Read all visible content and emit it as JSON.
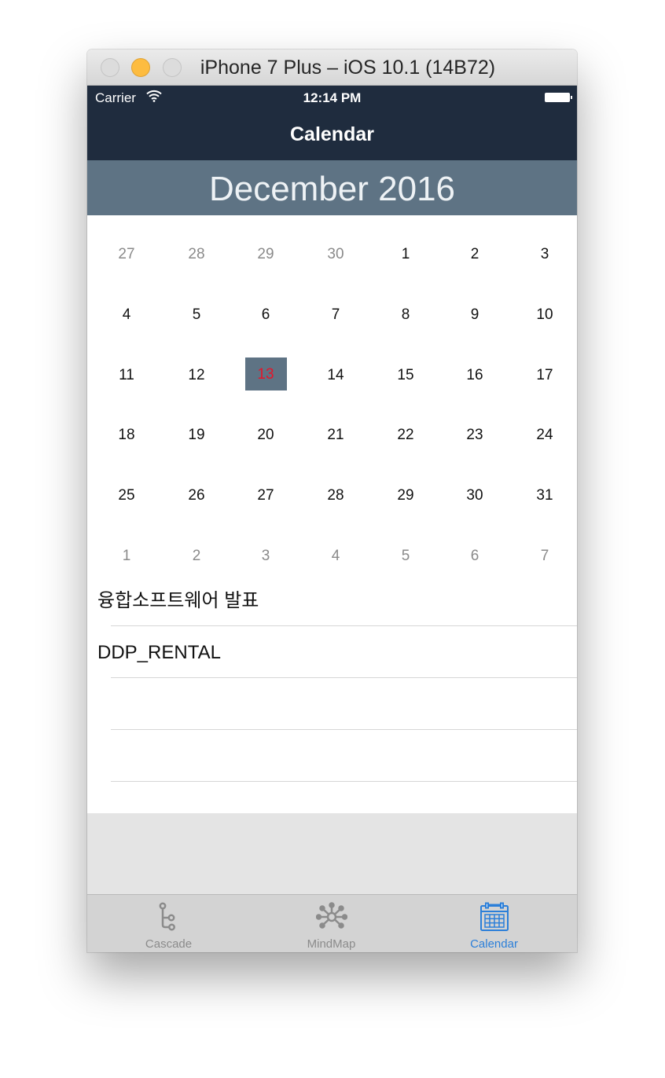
{
  "window": {
    "title": "iPhone 7 Plus – iOS 10.1 (14B72)"
  },
  "status_bar": {
    "carrier": "Carrier",
    "time": "12:14 PM"
  },
  "nav": {
    "title": "Calendar"
  },
  "calendar": {
    "month_title": "December 2016",
    "selected_day": "13",
    "colors": {
      "header_bg": "#5e7384",
      "selected_text": "#e5152a",
      "nav_bg": "#1f2c3e"
    },
    "weeks": [
      [
        {
          "d": "27",
          "o": true
        },
        {
          "d": "28",
          "o": true
        },
        {
          "d": "29",
          "o": true
        },
        {
          "d": "30",
          "o": true
        },
        {
          "d": "1",
          "o": false
        },
        {
          "d": "2",
          "o": false
        },
        {
          "d": "3",
          "o": false
        }
      ],
      [
        {
          "d": "4",
          "o": false
        },
        {
          "d": "5",
          "o": false
        },
        {
          "d": "6",
          "o": false
        },
        {
          "d": "7",
          "o": false
        },
        {
          "d": "8",
          "o": false
        },
        {
          "d": "9",
          "o": false
        },
        {
          "d": "10",
          "o": false
        }
      ],
      [
        {
          "d": "11",
          "o": false
        },
        {
          "d": "12",
          "o": false
        },
        {
          "d": "13",
          "o": false,
          "sel": true
        },
        {
          "d": "14",
          "o": false
        },
        {
          "d": "15",
          "o": false
        },
        {
          "d": "16",
          "o": false
        },
        {
          "d": "17",
          "o": false
        }
      ],
      [
        {
          "d": "18",
          "o": false
        },
        {
          "d": "19",
          "o": false
        },
        {
          "d": "20",
          "o": false
        },
        {
          "d": "21",
          "o": false
        },
        {
          "d": "22",
          "o": false
        },
        {
          "d": "23",
          "o": false
        },
        {
          "d": "24",
          "o": false
        }
      ],
      [
        {
          "d": "25",
          "o": false
        },
        {
          "d": "26",
          "o": false
        },
        {
          "d": "27",
          "o": false
        },
        {
          "d": "28",
          "o": false
        },
        {
          "d": "29",
          "o": false
        },
        {
          "d": "30",
          "o": false
        },
        {
          "d": "31",
          "o": false
        }
      ],
      [
        {
          "d": "1",
          "o": true
        },
        {
          "d": "2",
          "o": true
        },
        {
          "d": "3",
          "o": true
        },
        {
          "d": "4",
          "o": true
        },
        {
          "d": "5",
          "o": true
        },
        {
          "d": "6",
          "o": true
        },
        {
          "d": "7",
          "o": true
        }
      ]
    ]
  },
  "events": [
    "융합소프트웨어 발표",
    "DDP_RENTAL",
    "",
    ""
  ],
  "tab_bar": {
    "tabs": [
      {
        "label": "Cascade",
        "icon": "cascade-icon",
        "active": false
      },
      {
        "label": "MindMap",
        "icon": "mindmap-icon",
        "active": false
      },
      {
        "label": "Calendar",
        "icon": "calendar-icon",
        "active": true
      }
    ],
    "colors": {
      "active": "#2b7fd9",
      "inactive": "#8b8b8b"
    }
  }
}
